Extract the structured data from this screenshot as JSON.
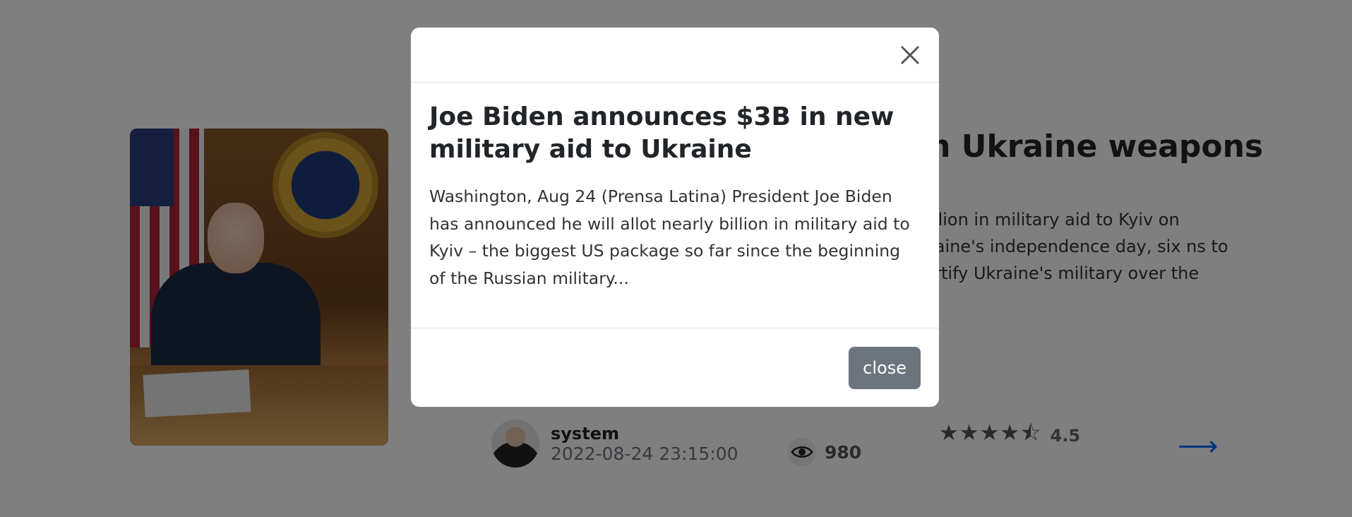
{
  "article": {
    "title_visible": "in Ukraine weapons",
    "description_visible": "billion in military aid to Kyiv on kraine's independence day, six ns to fortify Ukraine's military over the",
    "author": {
      "name": "system",
      "date": "2022-08-24 23:15:00"
    },
    "views": "980",
    "rating": {
      "value": "4.5",
      "stars": "★★★★⯪"
    },
    "next_arrow": "⟶"
  },
  "modal": {
    "title": "Joe Biden announces $3B in new military aid to Ukraine",
    "body": "Washington, Aug 24 (Prensa Latina) President Joe Biden has announced he will allot nearly billion in military aid to Kyiv – the biggest US package so far since the beginning of the Russian military...",
    "close_button_label": "close",
    "close_icon": "close-icon"
  },
  "colors": {
    "backdrop": "rgba(0,0,0,0.5)",
    "close_button_bg": "#6c757d",
    "arrow": "#0d6efd"
  }
}
